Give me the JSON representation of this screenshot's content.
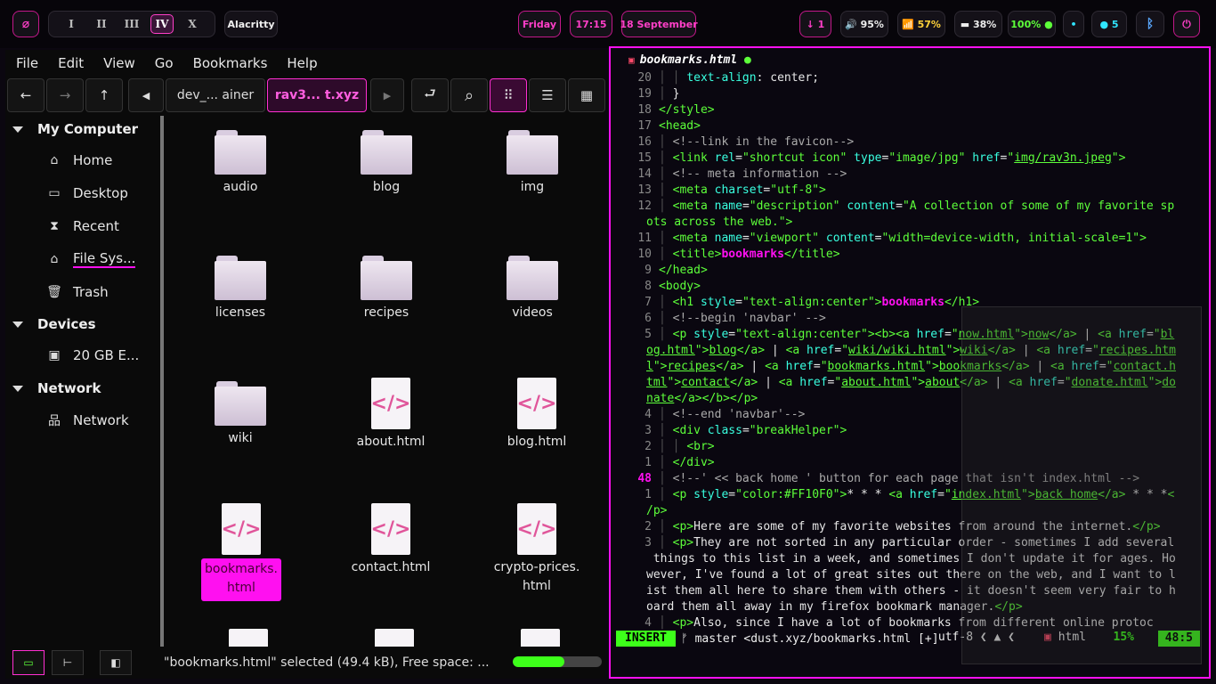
{
  "topbar": {
    "launcher_icon": "slash-circle-icon",
    "workspaces": [
      "I",
      "II",
      "III",
      "IV",
      "X"
    ],
    "active_workspace": "IV",
    "window_title": "Alacritty",
    "day": "Friday",
    "time": "17:15",
    "date": "18 September",
    "updates": "↓ 1",
    "volume": "🔊 95%",
    "wifi": "📶 57%",
    "brightness": "▬ 38%",
    "battery": "100% ●",
    "dot_icon": "•",
    "notifications": "● 5",
    "bluetooth_icon": "bluetooth-icon",
    "power_icon": "power-icon"
  },
  "filemanager": {
    "menu": [
      "File",
      "Edit",
      "View",
      "Go",
      "Bookmarks",
      "Help"
    ],
    "toolbar": {
      "back": "←",
      "forward": "→",
      "up": "↑",
      "crumb_prev": "◀",
      "crumb_1": "dev_... ainer",
      "crumb_2": "rav3... t.xyz",
      "crumb_next": "▶",
      "toggle": "⮐",
      "search": "⌕",
      "view_icons": "⠿",
      "view_list": "☰",
      "view_compact": "▦"
    },
    "sidebar": {
      "my_computer": "My Computer",
      "home": "Home",
      "desktop": "Desktop",
      "recent": "Recent",
      "filesystem": "File Sys...",
      "trash": "Trash",
      "devices": "Devices",
      "drive": "20 GB E...",
      "network_cat": "Network",
      "network": "Network"
    },
    "files": {
      "audio": "audio",
      "blog": "blog",
      "img": "img",
      "licenses": "licenses",
      "recipes": "recipes",
      "videos": "videos",
      "wiki": "wiki",
      "about": "about.html",
      "bloghtml": "blog.html",
      "bookmarks_1": "bookmarks.",
      "bookmarks_2": "html",
      "contact": "contact.html",
      "crypto_1": "crypto-prices.",
      "crypto_2": "html",
      "html_glyph": "</>"
    },
    "status": {
      "text": "\"bookmarks.html\" selected (49.4 kB), Free space: ...",
      "free_fraction": 0.58
    }
  },
  "terminal": {
    "filename": "bookmarks.html",
    "modified_dot": "●",
    "file_icon": "html5-icon",
    "line_numbers": [
      "20",
      "19",
      "18",
      "17",
      "16",
      "15",
      "14",
      "13",
      "12",
      "",
      "11",
      "10",
      "9",
      "8",
      "7",
      "6",
      "5",
      "",
      "",
      "",
      "",
      "4",
      "3",
      "2",
      "1",
      "48",
      "1",
      "",
      "2",
      "3",
      "",
      "",
      "",
      "",
      "4"
    ],
    "mode": "INSERT",
    "branch": "ᚠ master <dust.xyz/bookmarks.html [+]",
    "encoding": "utf-8 ❮ ▲ ❮",
    "filetype": "html",
    "percent": "15%",
    "position": "48:5"
  },
  "colors": {
    "accent": "#ff10f0",
    "green": "#3dff1a",
    "cyan": "#39ffe0"
  }
}
